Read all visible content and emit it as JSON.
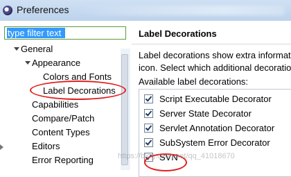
{
  "window": {
    "title": "Preferences"
  },
  "colors": {
    "accent": "#3399ff",
    "annotation": "#e02020",
    "filter_border": "#5a9a3a"
  },
  "left": {
    "filter": {
      "value": "",
      "placeholder": "type filter text"
    },
    "tree": [
      {
        "label": "General",
        "state": "open"
      },
      {
        "label": "Appearance",
        "state": "open"
      },
      {
        "label": "Colors and Fonts",
        "state": "leaf"
      },
      {
        "label": "Label Decorations",
        "state": "leaf",
        "annotated": true
      },
      {
        "label": "Capabilities",
        "state": "leaf"
      },
      {
        "label": "Compare/Patch",
        "state": "leaf"
      },
      {
        "label": "Content Types",
        "state": "leaf"
      },
      {
        "label": "Editors",
        "state": "closed"
      },
      {
        "label": "Error Reporting",
        "state": "leaf"
      }
    ]
  },
  "right": {
    "title": "Label Decorations",
    "description_line1": "Label decorations show extra information",
    "description_line2": "icon. Select which additional decorations",
    "list_label": "Available label decorations:",
    "decorators": [
      {
        "label": "Script Executable Decorator",
        "checked": true
      },
      {
        "label": "Server State Decorator",
        "checked": true
      },
      {
        "label": "Servlet Annotation Decorator",
        "checked": true
      },
      {
        "label": "SubSystem Error Decorator",
        "checked": true
      },
      {
        "label": "SVN",
        "checked": true,
        "annotated": true
      }
    ]
  },
  "watermark": "https://blog.csdn.net/qq_41018670"
}
